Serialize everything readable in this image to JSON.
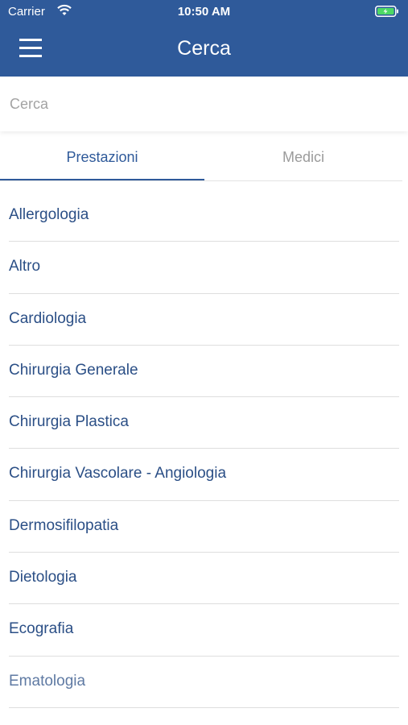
{
  "status_bar": {
    "carrier": "Carrier",
    "time": "10:50 AM"
  },
  "header": {
    "title": "Cerca"
  },
  "search": {
    "placeholder": "Cerca"
  },
  "tabs": [
    {
      "label": "Prestazioni",
      "active": true
    },
    {
      "label": "Medici",
      "active": false
    }
  ],
  "list": {
    "items": [
      "Allergologia",
      "Altro",
      "Cardiologia",
      "Chirurgia Generale",
      "Chirurgia Plastica",
      "Chirurgia Vascolare - Angiologia",
      "Dermosifilopatia",
      "Dietologia",
      "Ecografia",
      "Ematologia"
    ]
  },
  "colors": {
    "primary": "#2f5a9a",
    "battery": "#4cd964"
  },
  "icons": {
    "menu": "hamburger-menu-icon",
    "wifi": "wifi-icon",
    "battery": "battery-charging-icon"
  }
}
